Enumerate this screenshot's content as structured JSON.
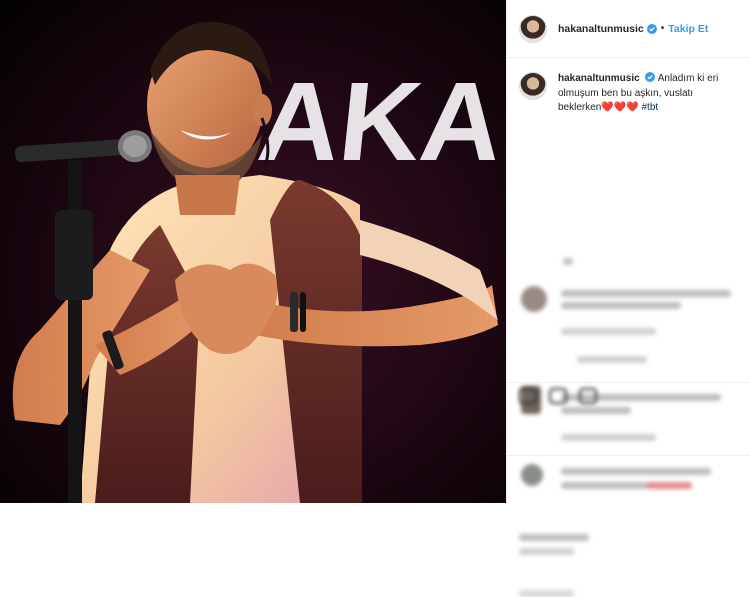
{
  "post": {
    "username": "hakanaltunmusic",
    "follow_label": "Takip Et",
    "caption_line1": "Anladım ki eri",
    "caption_line2": "olmuşum ben bu aşkın, vuslatı",
    "caption_line3": "beklerken",
    "hearts": "❤️❤️❤️",
    "hashtag": "#tbt"
  },
  "photo": {
    "stage_banner_text": "AKA"
  },
  "colors": {
    "link_blue": "#3897f0",
    "hashtag": "#003569",
    "verified": "#3897f0"
  }
}
